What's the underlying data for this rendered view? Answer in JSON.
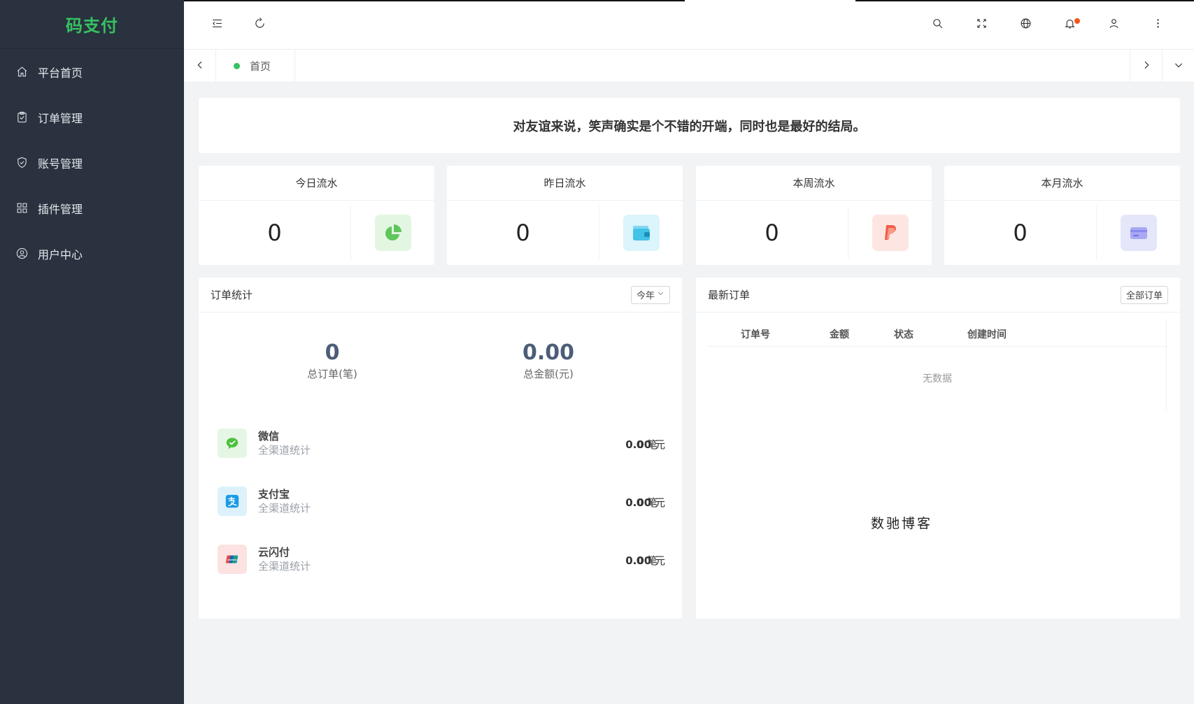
{
  "app": {
    "logo": "码支付"
  },
  "sidebar": {
    "items": [
      {
        "label": "平台首页",
        "icon": "home-icon"
      },
      {
        "label": "订单管理",
        "icon": "clipboard-check-icon"
      },
      {
        "label": "账号管理",
        "icon": "shield-check-icon"
      },
      {
        "label": "插件管理",
        "icon": "grid-icon"
      },
      {
        "label": "用户中心",
        "icon": "user-circle-icon"
      }
    ]
  },
  "header": {
    "icons": [
      "menu-fold-icon",
      "refresh-icon",
      "search-icon",
      "fullscreen-icon",
      "globe-icon",
      "bell-icon",
      "user-icon",
      "more-vertical-icon"
    ]
  },
  "tabs": {
    "home": "首页"
  },
  "banner": {
    "text": "对友谊来说，笑声确实是个不错的开端，同时也是最好的结局。"
  },
  "stats": [
    {
      "title": "今日流水",
      "value": "0",
      "icon": "pie-chart-icon",
      "color": "#5fc65b",
      "bg": "#e3f6e1"
    },
    {
      "title": "昨日流水",
      "value": "0",
      "icon": "wallet-icon",
      "color": "#43c3e8",
      "bg": "#dcf4fb"
    },
    {
      "title": "本周流水",
      "value": "0",
      "icon": "paypal-icon",
      "color": "#f25c4a",
      "bg": "#fde6e2"
    },
    {
      "title": "本月流水",
      "value": "0",
      "icon": "card-icon",
      "color": "#8b8bef",
      "bg": "#e6e6fb"
    }
  ],
  "orders_stats": {
    "title": "订单统计",
    "filter": "今年",
    "total_orders": {
      "value": "0",
      "label": "总订单(笔)"
    },
    "total_amount": {
      "value": "0.00",
      "label": "总金额(元)"
    },
    "channels": [
      {
        "name": "微信",
        "sub": "全渠道统计",
        "count": "0",
        "count_unit": "笔",
        "amount": "0.00",
        "amount_unit": "元",
        "icon": "wechat-icon",
        "color": "#4cc13f",
        "bg": "#e6f6e4"
      },
      {
        "name": "支付宝",
        "sub": "全渠道统计",
        "count": "0",
        "count_unit": "笔",
        "amount": "0.00",
        "amount_unit": "元",
        "icon": "alipay-icon",
        "color": "#1a9be6",
        "bg": "#dcf1fb"
      },
      {
        "name": "云闪付",
        "sub": "全渠道统计",
        "count": "0",
        "count_unit": "笔",
        "amount": "0.00",
        "amount_unit": "元",
        "icon": "unionpay-icon",
        "color": "#e04a4a",
        "bg": "#fde2e2"
      }
    ]
  },
  "latest_orders": {
    "title": "最新订单",
    "all_button": "全部订单",
    "columns": [
      "订单号",
      "金额",
      "状态",
      "创建时间"
    ],
    "empty": "无数据",
    "watermark": "数驰博客"
  }
}
